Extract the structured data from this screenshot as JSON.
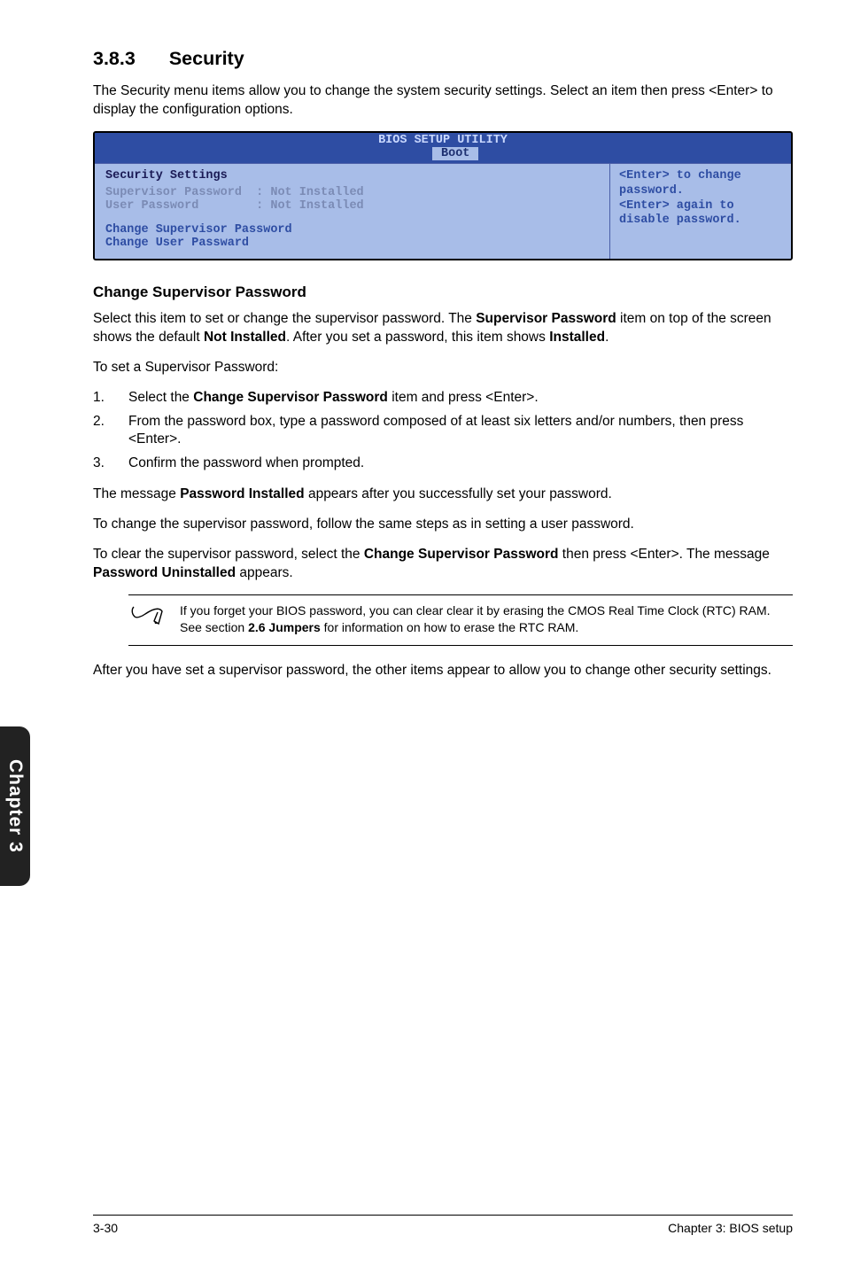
{
  "chapter_tab": "Chapter 3",
  "section": {
    "number": "3.8.3",
    "title": "Security"
  },
  "intro": "The Security menu items allow you to change the system security settings. Select an item then press <Enter> to display the configuration options.",
  "bios": {
    "title": "BIOS SETUP UTILITY",
    "tab": "Boot",
    "panel_heading": "Security Settings",
    "rows": [
      {
        "label": "Supervisor Password",
        "value": ": Not Installed"
      },
      {
        "label": "User Password",
        "value": ": Not Installed"
      }
    ],
    "links": [
      "Change Supervisor Password",
      "Change User Passward"
    ],
    "help": "<Enter> to change password.\n<Enter> again to disable password."
  },
  "subsection_heading": "Change Supervisor Password",
  "para_select": "Select this item to set or change the supervisor password. The ",
  "para_select_b1": "Supervisor Password",
  "para_select_mid": " item on top of the screen shows the default ",
  "para_select_b2": "Not Installed",
  "para_select_mid2": ". After you set a password, this item shows ",
  "para_select_b3": "Installed",
  "para_select_end": ".",
  "para_toset": "To set a Supervisor Password:",
  "steps": [
    {
      "n": "1.",
      "pre": "Select the ",
      "b": "Change Supervisor Password",
      "post": " item and press <Enter>."
    },
    {
      "n": "2.",
      "pre": "From the password box, type a password composed of at least six letters and/or numbers, then press <Enter>.",
      "b": "",
      "post": ""
    },
    {
      "n": "3.",
      "pre": "Confirm the password when prompted.",
      "b": "",
      "post": ""
    }
  ],
  "para_msg_pre": "The message ",
  "para_msg_b": "Password Installed",
  "para_msg_post": " appears after you successfully set your password.",
  "para_change": "To change the supervisor password, follow the same steps as in setting a user password.",
  "para_clear_pre": "To clear the supervisor password, select the ",
  "para_clear_b1": "Change Supervisor Password",
  "para_clear_mid": " then press <Enter>. The message ",
  "para_clear_b2": "Password Uninstalled",
  "para_clear_end": " appears.",
  "note_pre": "If you forget your BIOS password, you can clear clear it by erasing the CMOS Real Time Clock (RTC) RAM. See section ",
  "note_b": "2.6 Jumpers",
  "note_post": " for information on how to erase the RTC RAM.",
  "para_after": "After you have set a supervisor password, the other items appear to allow you to change other security settings.",
  "footer_left": "3-30",
  "footer_right": "Chapter 3: BIOS setup"
}
